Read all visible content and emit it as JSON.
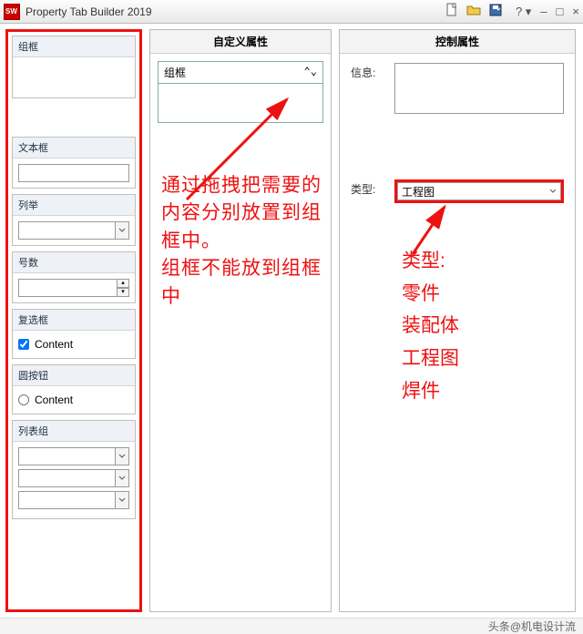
{
  "titlebar": {
    "title": "Property Tab Builder 2019"
  },
  "columns": {
    "mid_header": "自定义属性",
    "right_header": "控制属性"
  },
  "palette": {
    "group": "组框",
    "textbox": "文本框",
    "list": "列举",
    "number": "号数",
    "checkbox": "复选框",
    "checkbox_item": "Content",
    "radio": "圆按钮",
    "radio_item": "Content",
    "listgroup": "列表组"
  },
  "mid": {
    "groupbox_label": "组框"
  },
  "right": {
    "info_label": "信息:",
    "type_label": "类型:",
    "type_value": "工程图"
  },
  "annotations": {
    "mid_text": "通过拖拽把需要的内容分别放置到组框中。\n组框不能放到组框中",
    "right_text": "类型:\n零件\n装配体\n工程图\n焊件"
  },
  "footer": {
    "credit": "头条@机电设计流"
  }
}
